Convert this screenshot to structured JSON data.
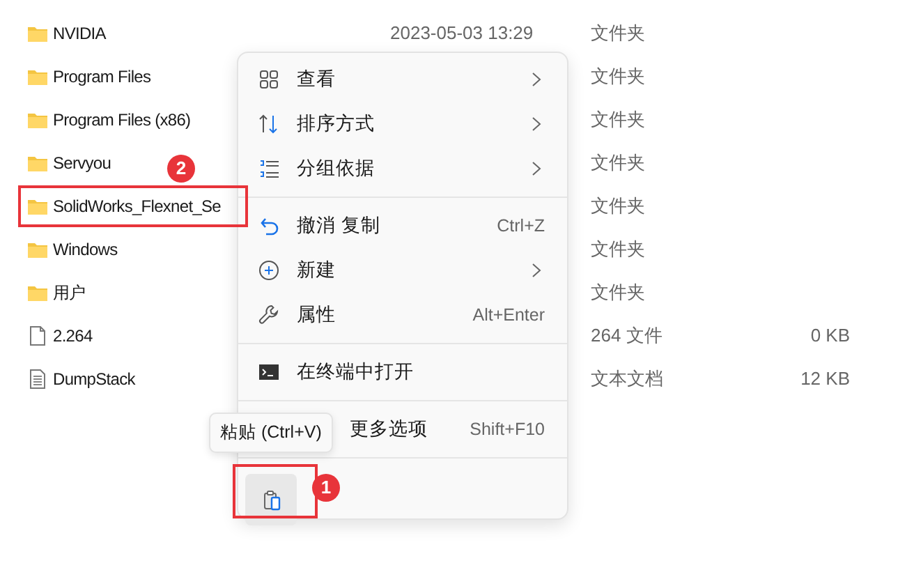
{
  "files": [
    {
      "kind": "folder",
      "name": "NVIDIA",
      "date": "2023-05-03 13:29",
      "type": "文件夹"
    },
    {
      "kind": "folder",
      "name": "Program Files",
      "type": "文件夹"
    },
    {
      "kind": "folder",
      "name": "Program Files (x86)",
      "type": "文件夹"
    },
    {
      "kind": "folder",
      "name": "Servyou",
      "type": "文件夹"
    },
    {
      "kind": "folder",
      "name": "SolidWorks_Flexnet_Se",
      "type": "文件夹"
    },
    {
      "kind": "folder",
      "name": "Windows",
      "type": "文件夹"
    },
    {
      "kind": "folder",
      "name": "用户",
      "type": "文件夹"
    },
    {
      "kind": "file",
      "name": "2.264",
      "type": "264 文件",
      "size": "0 KB"
    },
    {
      "kind": "document",
      "name": "DumpStack",
      "type": "文本文档",
      "size": "12 KB"
    }
  ],
  "context_menu": {
    "sections": [
      [
        {
          "label": "查看",
          "submenu": true
        },
        {
          "label": "排序方式",
          "submenu": true
        },
        {
          "label": "分组依据",
          "submenu": true
        }
      ],
      [
        {
          "label": "撤消 复制",
          "shortcut": "Ctrl+Z"
        },
        {
          "label": "新建",
          "submenu": true
        },
        {
          "label": "属性",
          "shortcut": "Alt+Enter"
        }
      ],
      [
        {
          "label": "在终端中打开"
        }
      ],
      [
        {
          "label": "更多选项",
          "shortcut": "Shift+F10"
        }
      ]
    ],
    "toolbar": [
      {
        "selected": true
      }
    ]
  },
  "tooltip": "粘贴 (Ctrl+V)",
  "annotations": [
    {
      "number": "2"
    },
    {
      "number": "1"
    }
  ]
}
